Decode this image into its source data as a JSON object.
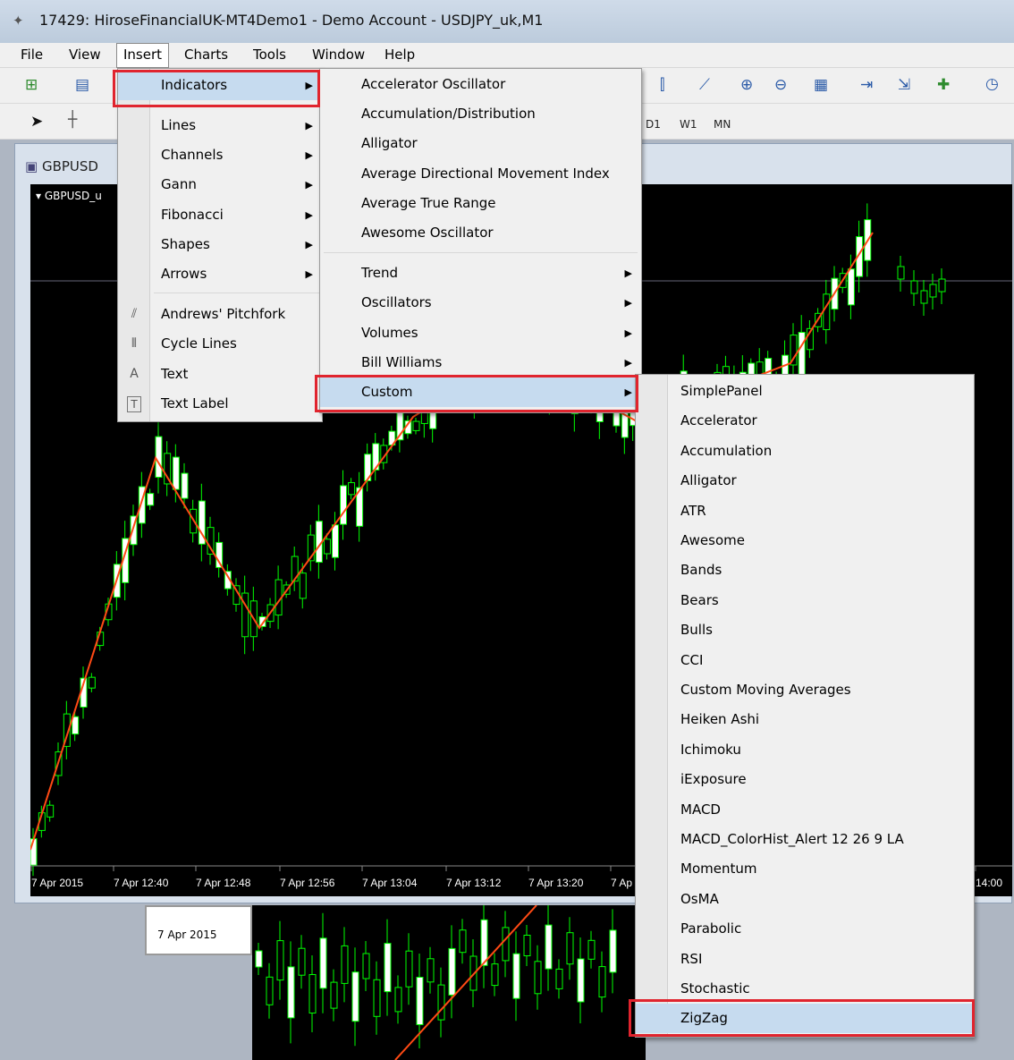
{
  "window": {
    "title": "17429: HiroseFinancialUK-MT4Demo1 - Demo Account - USDJPY_uk,M1"
  },
  "menubar": [
    "File",
    "View",
    "Insert",
    "Charts",
    "Tools",
    "Window",
    "Help"
  ],
  "timeframes": [
    "D1",
    "W1",
    "MN"
  ],
  "chart": {
    "tab_label": "GBPUSD",
    "symbol_label": "GBPUSD_u",
    "time_labels": [
      "7 Apr 2015",
      "7 Apr 12:40",
      "7 Apr 12:48",
      "7 Apr 12:56",
      "7 Apr 13:04",
      "7 Apr 13:12",
      "7 Apr 13:20",
      "7 Ap",
      "14:00"
    ],
    "second_chart_date": "7 Apr 2015",
    "colors": {
      "bull": "#00ff00",
      "line": "#ff4a14",
      "background": "#000000"
    }
  },
  "insert_menu": {
    "items": [
      {
        "label": "Indicators",
        "submenu": true
      },
      {
        "label": "Lines",
        "submenu": true
      },
      {
        "label": "Channels",
        "submenu": true
      },
      {
        "label": "Gann",
        "submenu": true
      },
      {
        "label": "Fibonacci",
        "submenu": true
      },
      {
        "label": "Shapes",
        "submenu": true
      },
      {
        "label": "Arrows",
        "submenu": true
      },
      {
        "label": "Andrews' Pitchfork",
        "icon": "pitchfork-icon"
      },
      {
        "label": "Cycle Lines",
        "icon": "cycle-lines-icon"
      },
      {
        "label": "Text",
        "icon": "text-icon"
      },
      {
        "label": "Text Label",
        "icon": "text-label-icon"
      }
    ]
  },
  "indicators_menu": {
    "items": [
      "Accelerator Oscillator",
      "Accumulation/Distribution",
      "Alligator",
      "Average Directional Movement Index",
      "Average True Range",
      "Awesome Oscillator"
    ],
    "submenus": [
      "Trend",
      "Oscillators",
      "Volumes",
      "Bill Williams",
      "Custom"
    ]
  },
  "custom_menu": {
    "items": [
      "SimplePanel",
      "Accelerator",
      "Accumulation",
      "Alligator",
      "ATR",
      "Awesome",
      "Bands",
      "Bears",
      "Bulls",
      "CCI",
      "Custom Moving Averages",
      "Heiken Ashi",
      "Ichimoku",
      "iExposure",
      "MACD",
      "MACD_ColorHist_Alert  12  26  9   LA",
      "Momentum",
      "OsMA",
      "Parabolic",
      "RSI",
      "Stochastic",
      "ZigZag"
    ]
  }
}
